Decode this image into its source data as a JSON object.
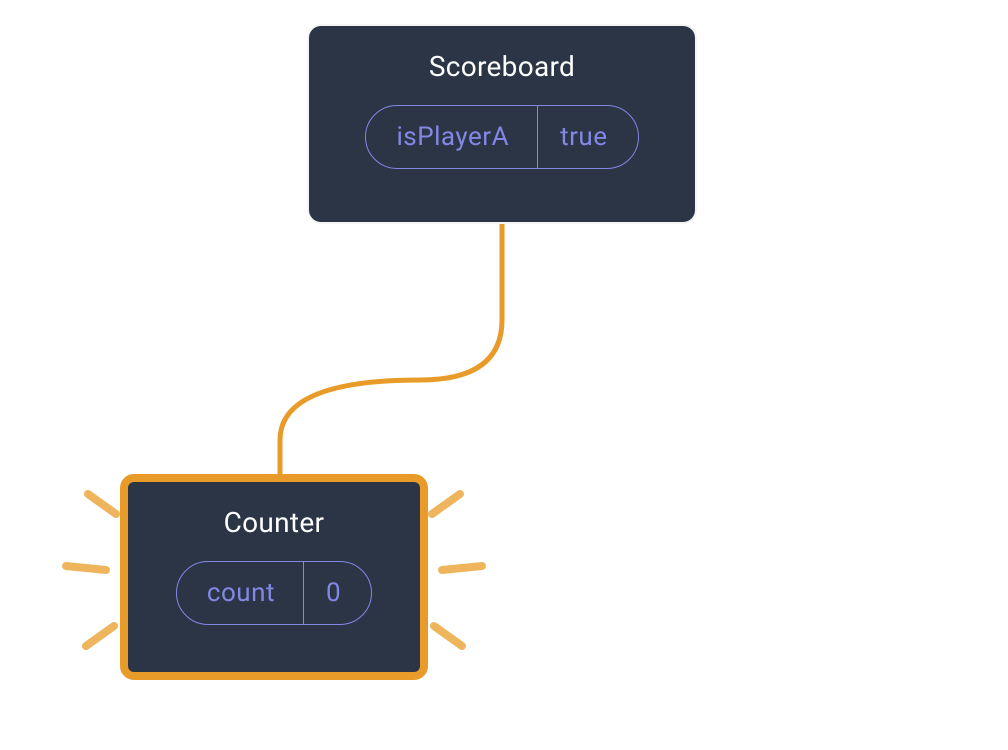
{
  "parent": {
    "title": "Scoreboard",
    "state_key": "isPlayerA",
    "state_value": "true"
  },
  "child": {
    "title": "Counter",
    "state_key": "count",
    "state_value": "0"
  },
  "colors": {
    "node_bg": "#2b3546",
    "accent": "#e99b29",
    "pill_border": "#8288e4",
    "text_light": "#ffffff"
  }
}
